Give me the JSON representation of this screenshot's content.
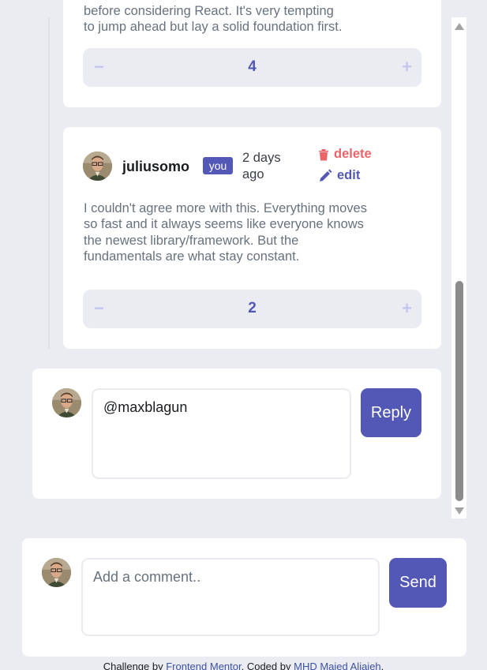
{
  "previous_comment": {
    "text_clipped_top": "before considering React. It's very tempting",
    "text_visible": "to jump ahead but lay a solid foundation first.",
    "score": "4",
    "minus": "−",
    "plus": "+"
  },
  "reply_comment": {
    "username": "juliusomo",
    "badge": "you",
    "timestamp": "2 days ago",
    "delete_label": "delete",
    "edit_label": "edit",
    "text": "I couldn't agree more with this. Everything moves so fast and it always seems like everyone knows the newest library/framework. But the fundamentals are what stay constant.",
    "score": "2",
    "minus": "−",
    "plus": "+"
  },
  "reply_form": {
    "value": "@maxblagun",
    "button_label": "Reply"
  },
  "add_comment": {
    "placeholder": "Add a comment..",
    "button_label": "Send"
  },
  "footer": {
    "prefix": "Challenge by ",
    "link1": "Frontend Mentor",
    "middle": ". Coded by ",
    "link2": "MHD Majed Aljajeh",
    "suffix": "."
  },
  "colors": {
    "accent": "#5357b6",
    "delete": "#ed6468",
    "background": "#eaecf1"
  },
  "icons": [
    "trash-icon",
    "pencil-icon",
    "avatar",
    "scroll-up-icon",
    "scroll-down-icon"
  ]
}
